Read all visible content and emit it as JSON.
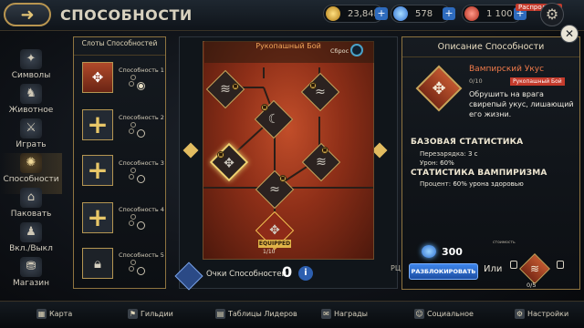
{
  "header": {
    "back_icon": "back-arrow-icon",
    "title": "СПОСОБНОСТИ",
    "currencies": [
      {
        "icon": "gold-coins-icon",
        "value": "23,84k"
      },
      {
        "icon": "gem-icon",
        "value": "578"
      },
      {
        "icon": "energy-icon",
        "value": "1 100"
      }
    ],
    "sale_badge": "Распродажа",
    "settings_icon": "gear-icon"
  },
  "sidebar": {
    "items": [
      {
        "label": "Символы",
        "icon": "symbols-icon",
        "glyph": "✦"
      },
      {
        "label": "Животное",
        "icon": "pet-icon",
        "glyph": "♞"
      },
      {
        "label": "Играть",
        "icon": "play-icon",
        "glyph": "⚔"
      },
      {
        "label": "Способности",
        "icon": "abilities-icon",
        "glyph": "✺"
      },
      {
        "label": "Паковать",
        "icon": "pack-icon",
        "glyph": "⌂"
      },
      {
        "label": "Вкл./Выкл",
        "icon": "toggle-icon",
        "glyph": "♟"
      },
      {
        "label": "Магазин",
        "icon": "shop-icon",
        "glyph": "⛃"
      }
    ]
  },
  "slots": {
    "title": "Слоты Способностей",
    "items": [
      {
        "label": "Способность 1",
        "state": "equipped"
      },
      {
        "label": "Способность 2",
        "state": "empty"
      },
      {
        "label": "Способность 3",
        "state": "empty"
      },
      {
        "label": "Способность 4",
        "state": "empty"
      },
      {
        "label": "Способность 5",
        "state": "locked"
      }
    ]
  },
  "tree": {
    "title": "Рукопашный Бой",
    "reset_label": "Сброс",
    "equipped_label": "EQUIPPED",
    "equipped_count": "1/10",
    "skill_points_label": "Очки Способностей",
    "skill_points_value": "0",
    "side_stub": "РЦ"
  },
  "description": {
    "panel_title": "Описание Способности",
    "ability_name": "Вампирский Укус",
    "ability_level": "0/10",
    "ability_tag": "Рукопашный Бой",
    "ability_text": "Обрушить на врага свирепый укус, лишающий его жизни.",
    "base_stats_title": "БАЗОВАЯ СТАТИСТИКА",
    "cooldown_label": "Перезарядка:",
    "cooldown_value": "3 с",
    "damage_label": "Урон:",
    "damage_value": "60%",
    "vamp_stats_title": "СТАТИСТИКА ВАМПИРИЗМА",
    "percent_label": "Процент:",
    "percent_value": "60% урона здоровью",
    "cost_label": "стоимость",
    "gem_cost": "300",
    "unlock_button": "РАЗБЛОКИРОВАТЬ",
    "or_label": "Или",
    "alt_count": "0/5"
  },
  "bottom_nav": [
    {
      "label": "Карта",
      "icon": "map-icon"
    },
    {
      "label": "Гильдии",
      "icon": "guild-icon"
    },
    {
      "label": "Таблицы Лидеров",
      "icon": "leaderboard-icon"
    },
    {
      "label": "Награды",
      "icon": "rewards-icon"
    },
    {
      "label": "Социальное",
      "icon": "social-icon"
    },
    {
      "label": "Настройки",
      "icon": "settings-icon"
    }
  ]
}
